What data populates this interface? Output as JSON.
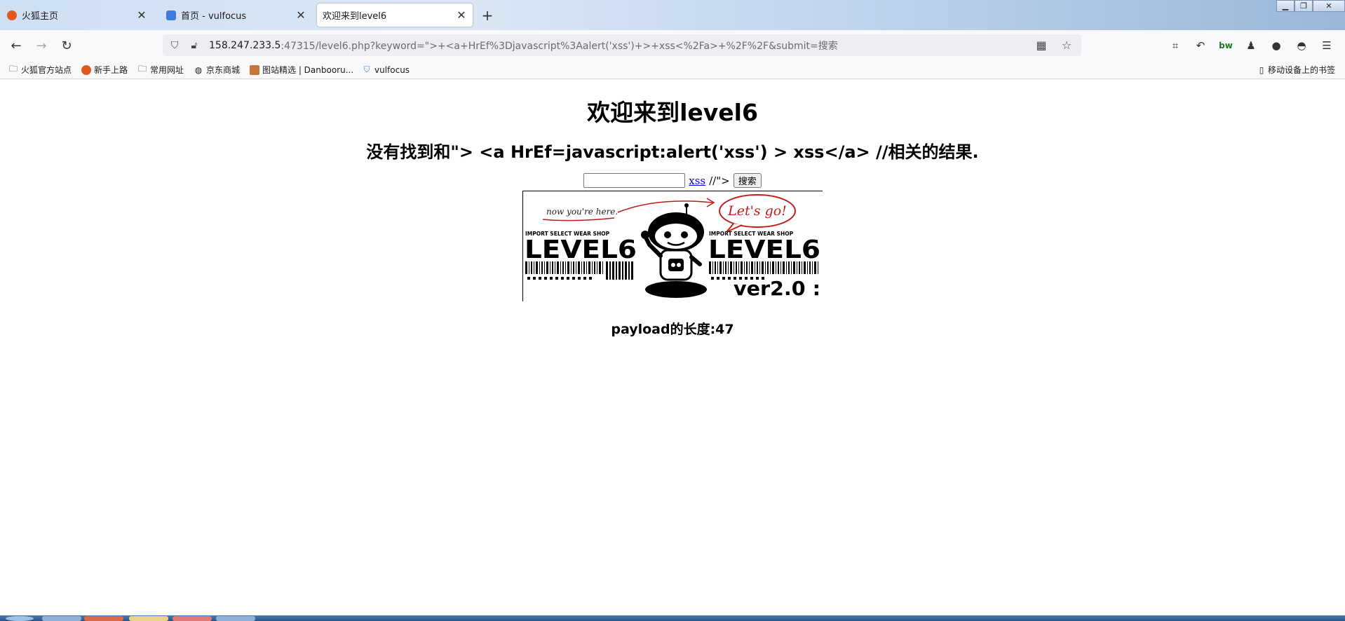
{
  "tabs": [
    {
      "label": "火狐主页",
      "favicon_color": "#e25920",
      "active": false
    },
    {
      "label": "首页 - vulfocus",
      "favicon_color": "#3b7ddd",
      "active": false
    },
    {
      "label": "欢迎来到level6",
      "favicon_color": "",
      "active": true
    }
  ],
  "newtab_label": "+",
  "url": {
    "host": "158.247.233.5",
    "rest": ":47315/level6.php?keyword=\">+<a+HrEf%3Djavascript%3Aalert('xss')+>+xss<%2Fa>+%2F%2F&submit=搜索"
  },
  "bookmarks": [
    {
      "label": "火狐官方站点",
      "icon": "folder-icon"
    },
    {
      "label": "新手上路",
      "icon": "firefox-icon"
    },
    {
      "label": "常用网址",
      "icon": "folder-icon"
    },
    {
      "label": "京东商城",
      "icon": "globe-icon"
    },
    {
      "label": "图站精选 | Danbooru...",
      "icon": "image-icon"
    },
    {
      "label": "vulfocus",
      "icon": "shield-icon"
    }
  ],
  "mobile_bookmarks": "移动设备上的书签",
  "page": {
    "title": "欢迎来到level6",
    "result": "没有找到和\"> <a HrEf=javascript:alert('xss') > xss</a> //相关的结果.",
    "search_value": "",
    "injected_link": "xss",
    "after_link": "//\">",
    "search_button": "搜索",
    "payload_length": "payload的长度:47"
  },
  "banner": {
    "note": "now you're here.",
    "speech": "Let's go!",
    "tagline": "IMPORT SELECT WEAR SHOP",
    "level": "LEVEL6",
    "version": "ver2.0 :"
  },
  "colors": {
    "accent_red": "#c41d1d",
    "link": "#0000ee"
  }
}
